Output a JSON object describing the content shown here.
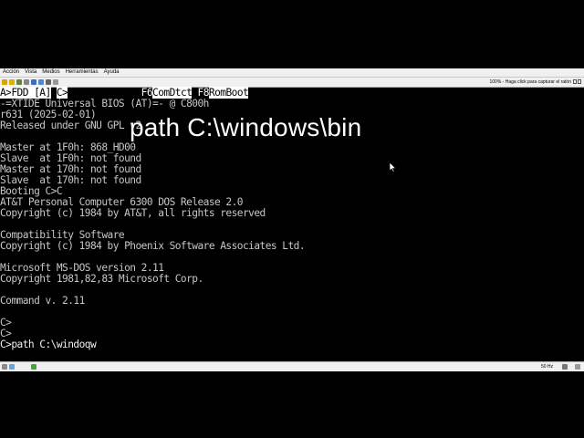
{
  "menu": {
    "items": [
      "Acción",
      "Vista",
      "Medios",
      "Herramientas",
      "Ayuda"
    ]
  },
  "toolbar": {
    "status_text": "100% - Haga click para capturar el ratón"
  },
  "terminal": {
    "bootbar": {
      "fdd_key": "A>",
      "fdd_label": "FDD [A]",
      "c_key": "C>",
      "c_label": "          ",
      "f6_key": "F6",
      "f6_label": "ComDtct",
      "f8_key": "F8",
      "f8_label": "RomBoot"
    },
    "lines": [
      "-=XTIDE Universal BIOS (AT)=- @ C800h",
      "r631 (2025-02-01)",
      "Released under GNU GPL v2",
      "",
      "Master at 1F0h: 868_HD00",
      "Slave  at 1F0h: not found",
      "Master at 170h: not found",
      "Slave  at 170h: not found",
      "Booting C>C",
      "AT&T Personal Computer 6300 DOS Release 2.0",
      "Copyright (c) 1984 by AT&T, all rights reserved",
      "",
      "Compatibility Software",
      "Copyright (c) 1984 by Phoenix Software Associates Ltd.",
      "",
      "Microsoft MS-DOS version 2.11",
      "Copyright 1981,82,83 Microsoft Corp.",
      "",
      "Command v. 2.11",
      "",
      "C>",
      "C>",
      "C>path C:\\windoqw"
    ]
  },
  "statusbar": {
    "fps": "50 Hz"
  },
  "caption": {
    "text": "path C:\\windows\\bin"
  },
  "colors": {
    "terminal_text": "#c6c6c6",
    "window_chrome": "#f0f0f0",
    "caption": "#ffffff"
  }
}
